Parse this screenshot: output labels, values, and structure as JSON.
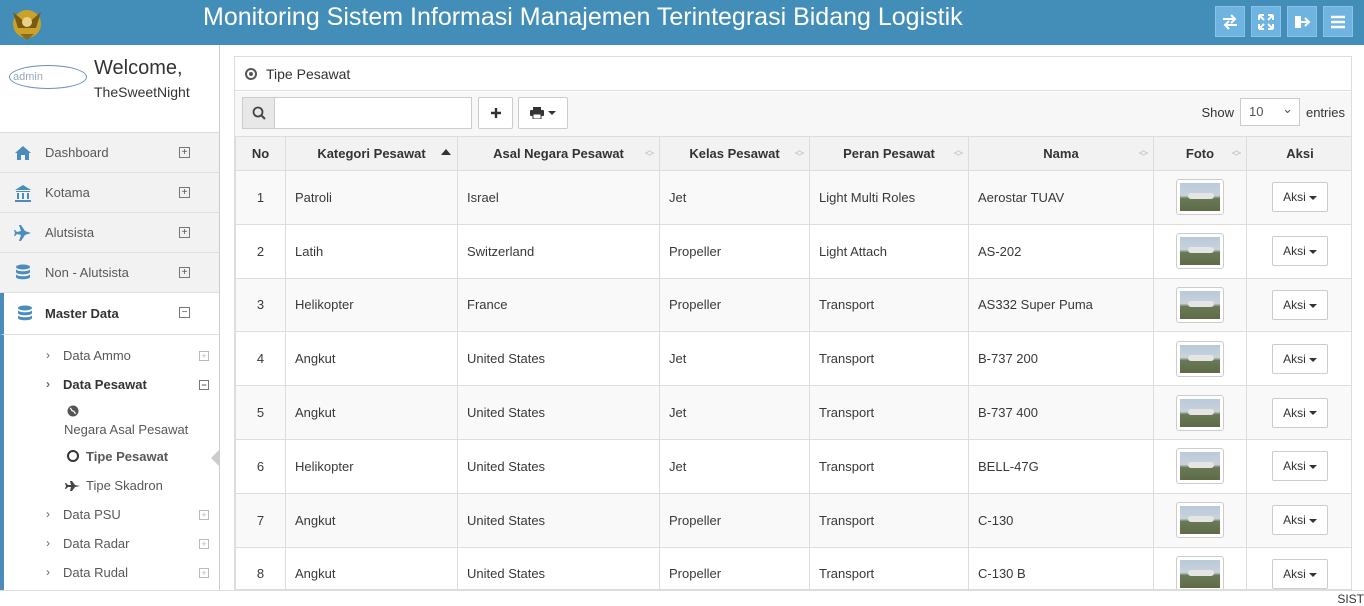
{
  "app_title": "Monitoring Sistem Informasi Manajemen Terintegrasi Bidang Logistik",
  "colors": {
    "topbar": "#438eb9",
    "accent": "#4a8dbd"
  },
  "user": {
    "avatar_text": "admin",
    "welcome": "Welcome,",
    "name": "TheSweetNight"
  },
  "sidebar": {
    "items": [
      {
        "label": "Dashboard",
        "icon": "home-icon"
      },
      {
        "label": "Kotama",
        "icon": "bank-icon"
      },
      {
        "label": "Alutsista",
        "icon": "plane-icon"
      },
      {
        "label": "Non - Alutsista",
        "icon": "database-icon"
      },
      {
        "label": "Master Data",
        "icon": "database-icon"
      }
    ],
    "sub_items": [
      "Data Ammo",
      "Data Pesawat",
      "Data PSU",
      "Data Radar",
      "Data Rudal"
    ],
    "pesawat_children": [
      "Negara Asal Pesawat",
      "Tipe Pesawat",
      "Tipe Skadron"
    ]
  },
  "panel": {
    "title": "Tipe Pesawat"
  },
  "toolbar": {
    "search_value": "",
    "show_label": "Show",
    "entries_label": "entries",
    "page_size": "10"
  },
  "table": {
    "columns": [
      "No",
      "Kategori Pesawat",
      "Asal Negara Pesawat",
      "Kelas Pesawat",
      "Peran Pesawat",
      "Nama",
      "Foto",
      "Aksi"
    ],
    "action_label": "Aksi",
    "rows": [
      [
        "1",
        "Patroli",
        "Israel",
        "Jet",
        "Light Multi Roles",
        "Aerostar TUAV"
      ],
      [
        "2",
        "Latih",
        "Switzerland",
        "Propeller",
        "Light Attach",
        "AS-202"
      ],
      [
        "3",
        "Helikopter",
        "France",
        "Propeller",
        "Transport",
        "AS332 Super Puma"
      ],
      [
        "4",
        "Angkut",
        "United States",
        "Jet",
        "Transport",
        "B-737 200"
      ],
      [
        "5",
        "Angkut",
        "United States",
        "Jet",
        "Transport",
        "B-737 400"
      ],
      [
        "6",
        "Helikopter",
        "United States",
        "Jet",
        "Transport",
        "BELL-47G"
      ],
      [
        "7",
        "Angkut",
        "United States",
        "Propeller",
        "Transport",
        "C-130"
      ],
      [
        "8",
        "Angkut",
        "United States",
        "Propeller",
        "Transport",
        "C-130 B"
      ]
    ]
  },
  "footer": {
    "text": "SIST"
  }
}
